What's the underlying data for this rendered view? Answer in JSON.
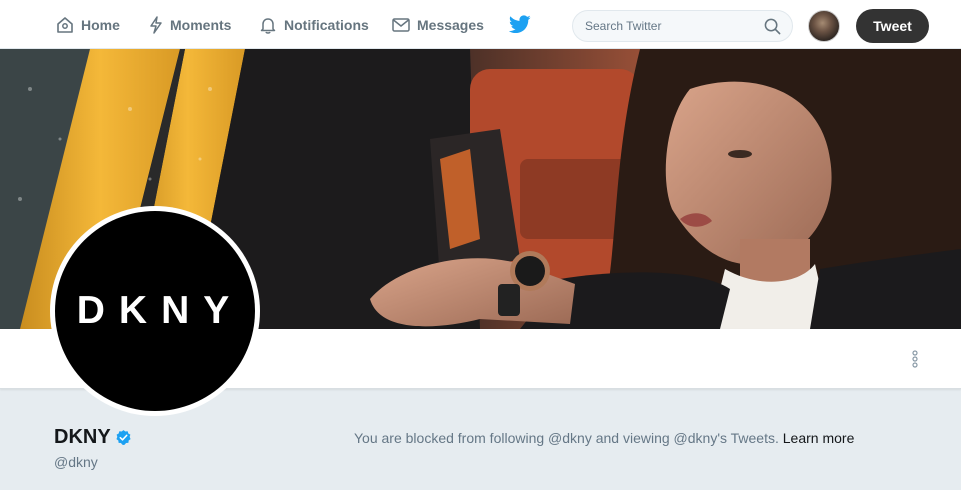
{
  "nav": {
    "home": "Home",
    "moments": "Moments",
    "notifications": "Notifications",
    "messages": "Messages",
    "tweet": "Tweet"
  },
  "search": {
    "placeholder": "Search Twitter"
  },
  "avatar_logo": "DKNY",
  "profile": {
    "name": "DKNY",
    "handle": "@dkny",
    "verified": true
  },
  "blocked": {
    "message": "You are blocked from following @dkny and viewing @dkny's Tweets.",
    "link": "Learn more"
  },
  "colors": {
    "twitter_blue": "#1da1f2",
    "nav_text": "#66757f",
    "tweet_button": "#333333",
    "page_bg": "#e6ecf0",
    "taxi_yellow": "#f2b531"
  },
  "icons": [
    "home-icon",
    "moments-icon",
    "notifications-icon",
    "messages-icon",
    "twitter-bird-icon",
    "search-icon",
    "more-icon",
    "verified-icon"
  ]
}
